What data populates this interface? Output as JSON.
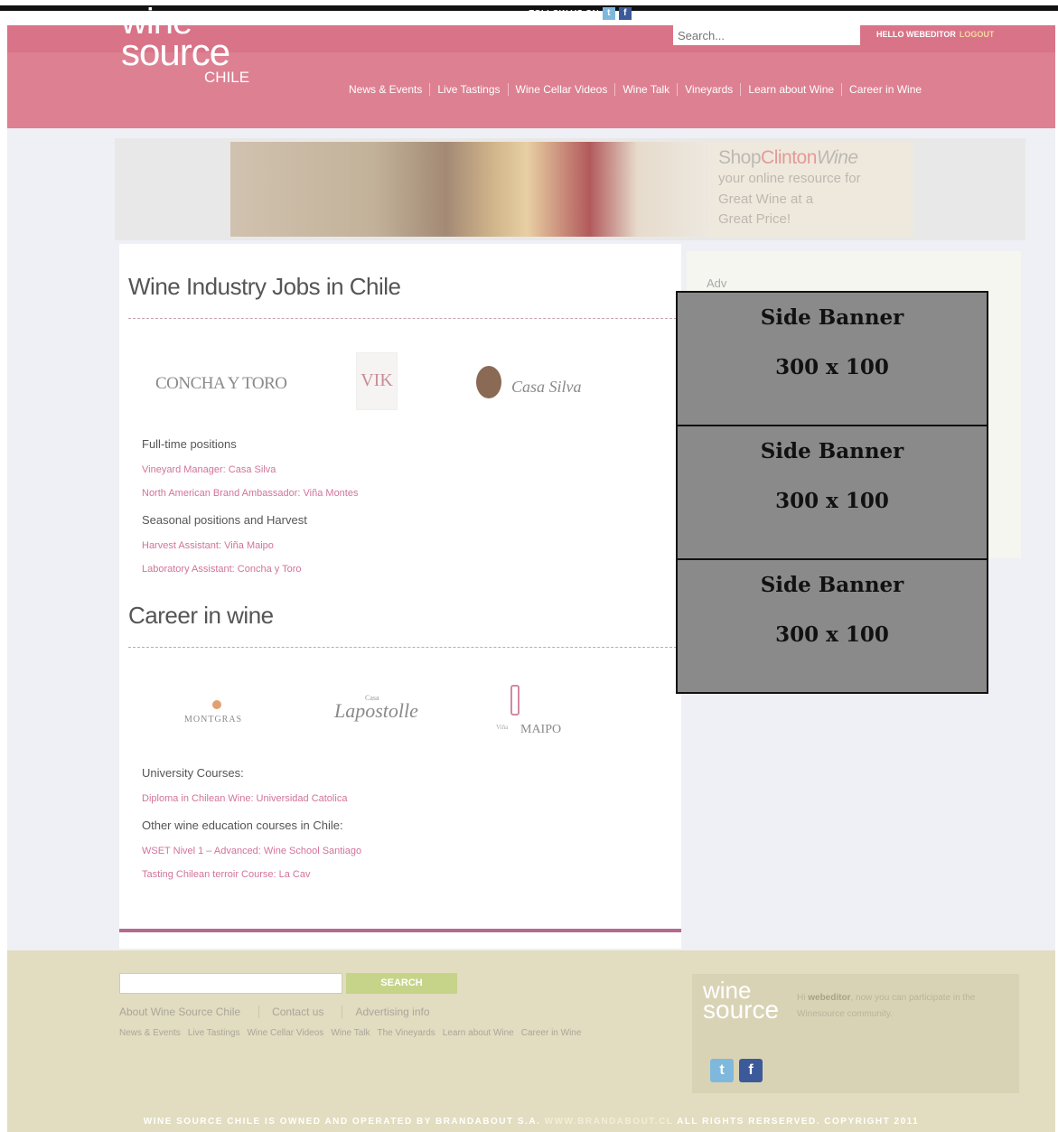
{
  "header": {
    "logo": {
      "line1": "wine",
      "line2": "source",
      "line3": "CHILE"
    },
    "follow_label": "FOLLOW US ON",
    "twitter_icon": "t",
    "facebook_icon": "f",
    "search_placeholder": "Search...",
    "hello_label": "HELLO WEBEDITOR",
    "logout_label": "LOGOUT",
    "nav": [
      "News & Events",
      "Live Tastings",
      "Wine Cellar Videos",
      "Wine Talk",
      "Vineyards",
      "Learn about Wine",
      "Career in Wine"
    ]
  },
  "banner": {
    "brand_shop": "Shop",
    "brand_clinton": "Clinton",
    "brand_wine": "Wine",
    "line1": "your online resource for",
    "line2": "Great Wine at a",
    "line3": "Great Price!"
  },
  "sidebar": {
    "label": "Adv"
  },
  "jobs": {
    "title": "Wine Industry Jobs in Chile",
    "logos": {
      "concha": "CONCHA Y TORO",
      "vik": "VIK",
      "casa_silva": "Casa Silva"
    },
    "fulltime_label": "Full-time positions",
    "fulltime_links": [
      "Vineyard Manager: Casa Silva",
      "North American Brand Ambassador: Viña Montes"
    ],
    "seasonal_label": "Seasonal positions and Harvest",
    "seasonal_links": [
      "Harvest Assistant: Viña Maipo",
      "Laboratory Assistant: Concha y Toro"
    ]
  },
  "career": {
    "title": "Career in wine",
    "logos": {
      "montgras": "MONTGRAS",
      "lapostolle_small": "Casa",
      "lapostolle": "Lapostolle",
      "maipo_small": "Viña",
      "maipo": "MAIPO"
    },
    "university_label": "University Courses:",
    "university_links": [
      "Diploma in Chilean Wine: Universidad Catolica"
    ],
    "other_label": "Other wine education courses in Chile:",
    "other_links": [
      "WSET Nivel 1 – Advanced: Wine School Santiago",
      "Tasting Chilean terroir Course: La Cav"
    ]
  },
  "side_banners": [
    {
      "title": "Side Banner",
      "size": "300 x 100"
    },
    {
      "title": "Side Banner",
      "size": "300 x 100"
    },
    {
      "title": "Side Banner",
      "size": "300 x 100"
    }
  ],
  "footer": {
    "search_label": "SEARCH",
    "links1": [
      "About Wine Source Chile",
      "Contact us",
      "Advertising info"
    ],
    "links2": [
      "News & Events",
      "Live Tastings",
      "Wine Cellar Videos",
      "Wine Talk",
      "The Vineyards",
      "Learn about Wine",
      "Career in Wine"
    ],
    "logo_line1": "wine",
    "logo_line2": "source",
    "message_hi": "Hi",
    "message_user": "webeditor",
    "message_rest": ", now you can participate in the Winesource community.",
    "copyright_pre": "WINE SOURCE CHILE IS OWNED AND OPERATED BY BRANDABOUT S.A.",
    "copyright_url": "WWW.BRANDABOUT.CL",
    "copyright_post": "ALL RIGHTS RERSERVED. COPYRIGHT 2011"
  },
  "colors": {
    "header": "#dd8092",
    "link": "#d27399",
    "footer": "#e2dcc0",
    "side_banner": "#8a8a8a"
  }
}
